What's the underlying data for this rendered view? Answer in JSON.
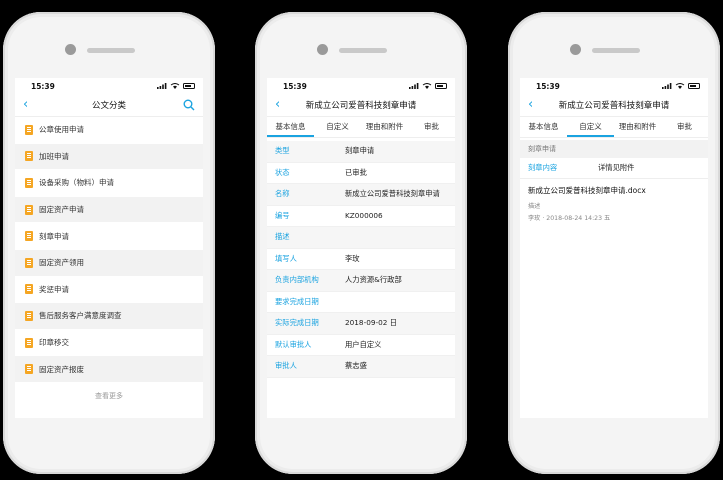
{
  "status": {
    "time": "15:39"
  },
  "phone1": {
    "title": "公文分类",
    "items": [
      "公章使用申请",
      "加班申请",
      "设备采购（物料）申请",
      "固定资产申请",
      "刻章申请",
      "固定资产领用",
      "奖惩申请",
      "售后服务客户满意度调查",
      "印章移交",
      "固定资产报废"
    ],
    "more": "查看更多"
  },
  "phone2": {
    "title": "新成立公司爱普科技刻章申请",
    "tabs": [
      "基本信息",
      "自定义",
      "理由和附件",
      "审批"
    ],
    "rows": [
      {
        "k": "类型",
        "v": "刻章申请"
      },
      {
        "k": "状态",
        "v": "已审批"
      },
      {
        "k": "名称",
        "v": "新成立公司爱普科技刻章申请"
      },
      {
        "k": "编号",
        "v": "KZ000006"
      },
      {
        "k": "描述",
        "v": ""
      },
      {
        "k": "填写人",
        "v": "李玫"
      },
      {
        "k": "负责内部机构",
        "v": "人力资源&行政部"
      },
      {
        "k": "要求完成日期",
        "v": ""
      },
      {
        "k": "实际完成日期",
        "v": "2018-09-02 日"
      },
      {
        "k": "默认审批人",
        "v": "用户自定义"
      },
      {
        "k": "审批人",
        "v": "蔡志盛"
      }
    ]
  },
  "phone3": {
    "title": "新成立公司爱普科技刻章申请",
    "tabs": [
      "基本信息",
      "自定义",
      "理由和附件",
      "审批"
    ],
    "section": "刻章申请",
    "row": {
      "k": "刻章内容",
      "v": "详情见附件"
    },
    "attachment": {
      "name": "新成立公司爱普科技刻章申请.docx",
      "desc": "描述",
      "meta": "李玫 · 2018-08-24 14:23 五"
    }
  }
}
